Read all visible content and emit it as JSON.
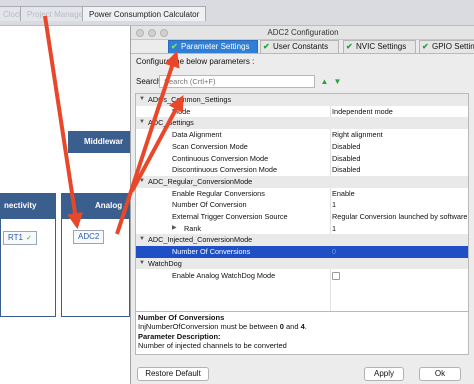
{
  "background_app": {
    "tabs": [
      {
        "label": "Clock Configuration"
      },
      {
        "label": "Project Manager"
      },
      {
        "label": "Power Consumption Calculator"
      }
    ],
    "middleware_header": "Middlewar",
    "connectivity_header": "nectivity",
    "analog_header": "Analog",
    "chip_left": "RT1",
    "chip_analog": "ADC2"
  },
  "dialog": {
    "title": "ADC2 Configuration",
    "tabs": [
      {
        "label": "Parameter Settings",
        "active": true
      },
      {
        "label": "User Constants"
      },
      {
        "label": "NVIC Settings"
      },
      {
        "label": "GPIO Settings"
      }
    ],
    "configure_label": "Configure the below parameters :",
    "search_label": "Search",
    "search_placeholder": "Search (Crtl+F)",
    "rows": [
      {
        "kind": "group",
        "label": "ADCs_Common_Settings"
      },
      {
        "kind": "param",
        "label": "Mode",
        "value": "Independent mode"
      },
      {
        "kind": "group",
        "label": "ADC_Settings"
      },
      {
        "kind": "param",
        "label": "Data Alignment",
        "value": "Right alignment"
      },
      {
        "kind": "param",
        "label": "Scan Conversion Mode",
        "value": "Disabled"
      },
      {
        "kind": "param",
        "label": "Continuous Conversion Mode",
        "value": "Disabled"
      },
      {
        "kind": "param",
        "label": "Discontinuous Conversion Mode",
        "value": "Disabled"
      },
      {
        "kind": "group",
        "label": "ADC_Regular_ConversionMode"
      },
      {
        "kind": "param",
        "label": "Enable Regular Conversions",
        "value": "Enable"
      },
      {
        "kind": "param",
        "label": "Number Of Conversion",
        "value": "1"
      },
      {
        "kind": "param",
        "label": "External Trigger Conversion Source",
        "value": "Regular Conversion launched by software"
      },
      {
        "kind": "sub",
        "label": "Rank",
        "value": "1"
      },
      {
        "kind": "group",
        "label": "ADC_Injected_ConversionMode"
      },
      {
        "kind": "selected",
        "label": "Number Of Conversions",
        "value": "0"
      },
      {
        "kind": "group",
        "label": "WatchDog"
      },
      {
        "kind": "check",
        "label": "Enable Analog WatchDog Mode",
        "value": ""
      }
    ],
    "description": {
      "heading": "Number Of Conversions",
      "line1_prefix": "InjNumberOfConversion must be between ",
      "line1_min": "0",
      "line1_mid": " and ",
      "line1_max": "4",
      "line1_suffix": ".",
      "param_desc_label": "Parameter Description:",
      "param_desc_text": "Number of injected channels to be converted"
    },
    "buttons": {
      "restore_default": "Restore Default",
      "apply": "Apply",
      "ok": "Ok"
    }
  },
  "colors": {
    "active_tab": "#2f7fd6",
    "selected_row": "#1e4fc4",
    "header_blue": "#3a5f8e",
    "annotation_arrow": "#e8472a"
  }
}
